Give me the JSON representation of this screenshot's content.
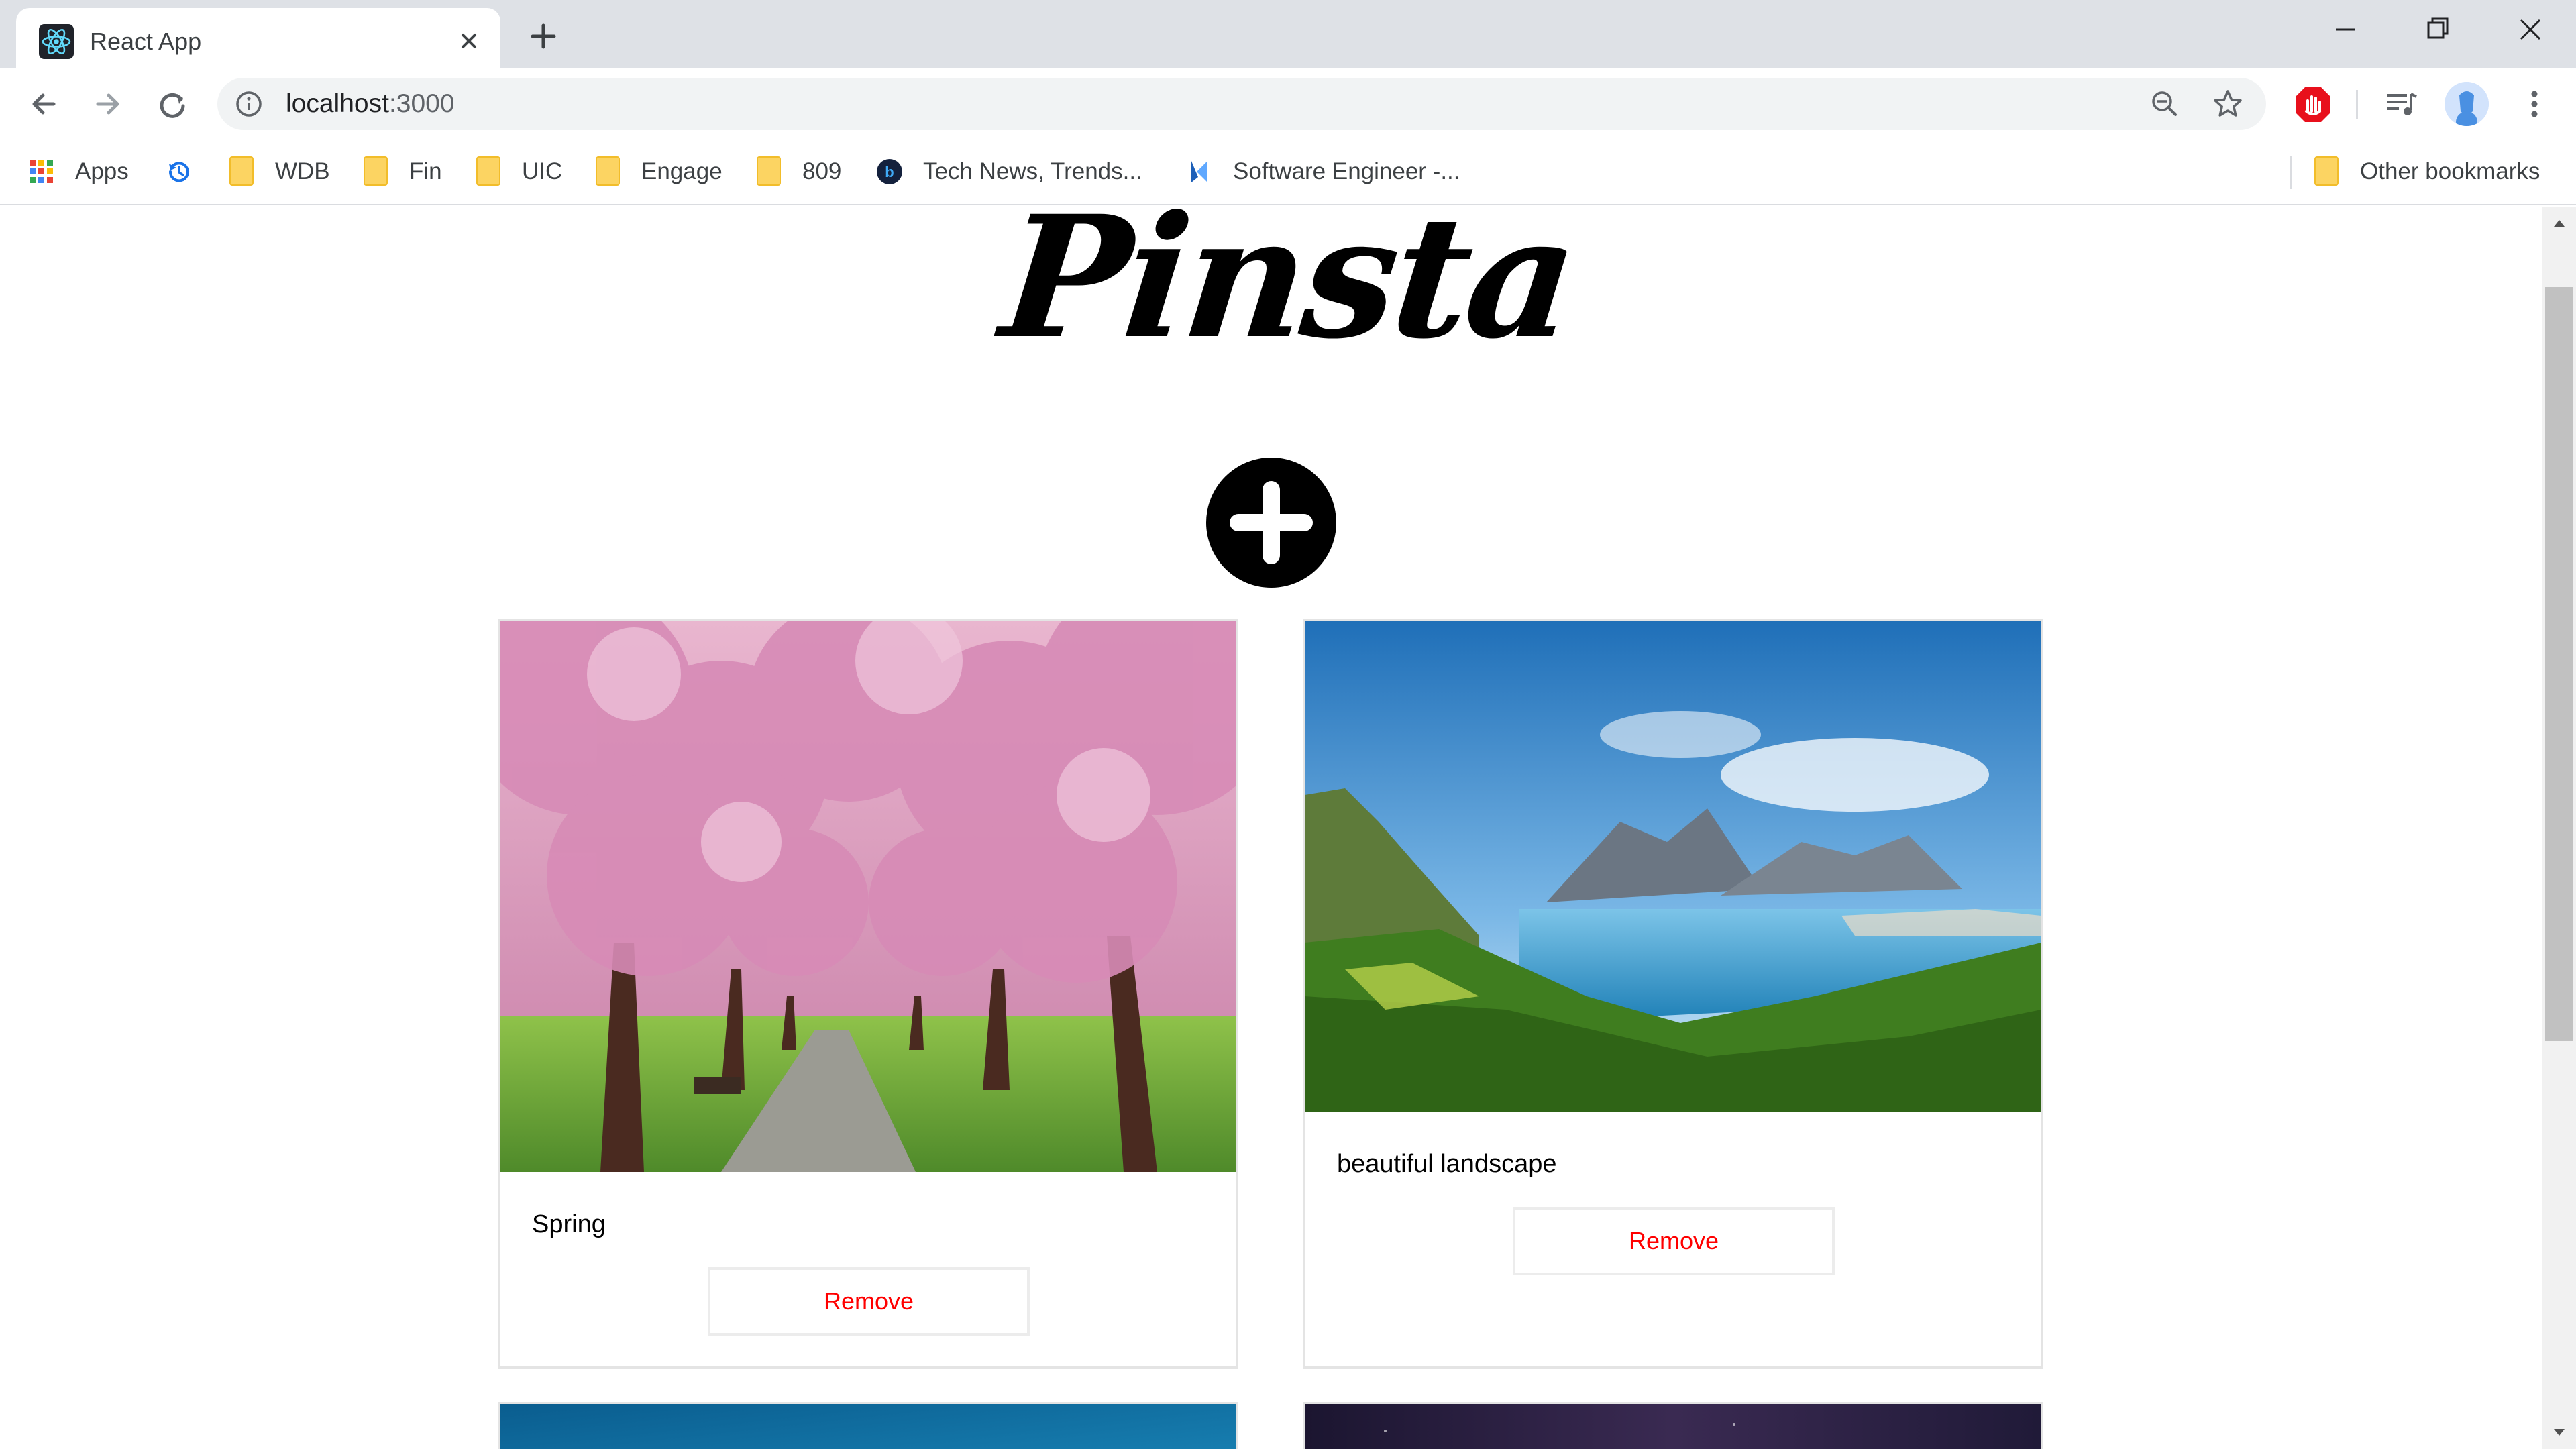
{
  "window": {
    "tab": {
      "title": "React App"
    }
  },
  "toolbar": {
    "url_host": "localhost",
    "url_port": ":3000"
  },
  "bookmarks": {
    "items": [
      {
        "label": "Apps",
        "icon": "apps-grid-icon"
      },
      {
        "label": "",
        "icon": "history-icon"
      },
      {
        "label": "WDB",
        "icon": "folder-icon"
      },
      {
        "label": "Fin",
        "icon": "folder-icon"
      },
      {
        "label": "UIC",
        "icon": "folder-icon"
      },
      {
        "label": "Engage",
        "icon": "folder-icon"
      },
      {
        "label": "809",
        "icon": "folder-icon"
      },
      {
        "label": "Tech News, Trends...",
        "icon": "b-logo-icon"
      },
      {
        "label": "Software Engineer -...",
        "icon": "k-logo-icon"
      }
    ],
    "other": "Other bookmarks"
  },
  "page": {
    "brand": "Pinsta",
    "cards": [
      {
        "caption": "Spring",
        "remove_label": "Remove"
      },
      {
        "caption": "beautiful landscape",
        "remove_label": "Remove"
      }
    ]
  },
  "colors": {
    "accent_remove": "#ff0000",
    "tabstrip": "#dee1e6",
    "omnibox": "#f1f3f4",
    "folder": "#fcd462"
  }
}
